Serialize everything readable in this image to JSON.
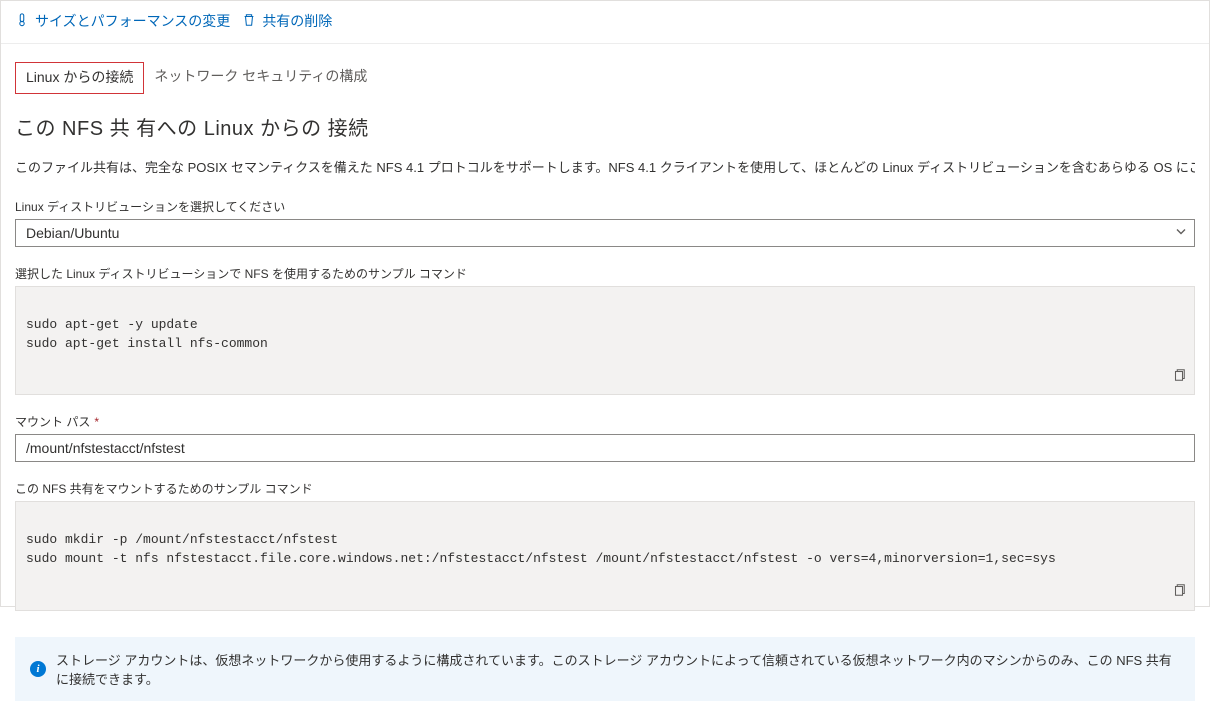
{
  "toolbar": {
    "change_size_label": "サイズとパフォーマンスの変更",
    "delete_share_label": "共有の削除"
  },
  "tabs": {
    "linux_connect": "Linux からの接続",
    "network_security": "ネットワーク セキュリティの構成"
  },
  "heading": "この NFS 共 有への Linux からの 接続",
  "description": "このファイル共有は、完全な POSIX セマンティクスを備えた NFS 4.1 プロトコルをサポートします。NFS 4.1 クライアントを使用して、ほとんどの Linux ディストリビューションを含むあらゆる OS にこの共有をマウント",
  "labels": {
    "select_distro": "Linux ディストリビューションを選択してください",
    "sample_use_nfs": "選択した Linux ディストリビューションで NFS を使用するためのサンプル コマンド",
    "mount_path": "マウント パス",
    "sample_mount": "この NFS 共有をマウントするためのサンプル コマンド"
  },
  "distro_select": "Debian/Ubuntu",
  "code_install": "sudo apt-get -y update\nsudo apt-get install nfs-common",
  "mount_path_value": "/mount/nfstestacct/nfstest",
  "code_mount": "sudo mkdir -p /mount/nfstestacct/nfstest\nsudo mount -t nfs nfstestacct.file.core.windows.net:/nfstestacct/nfstest /mount/nfstestacct/nfstest -o vers=4,minorversion=1,sec=sys",
  "info_text": "ストレージ アカウントは、仮想ネットワークから使用するように構成されています。このストレージ アカウントによって信頼されている仮想ネットワーク内のマシンからのみ、この NFS 共有に接続できます。"
}
